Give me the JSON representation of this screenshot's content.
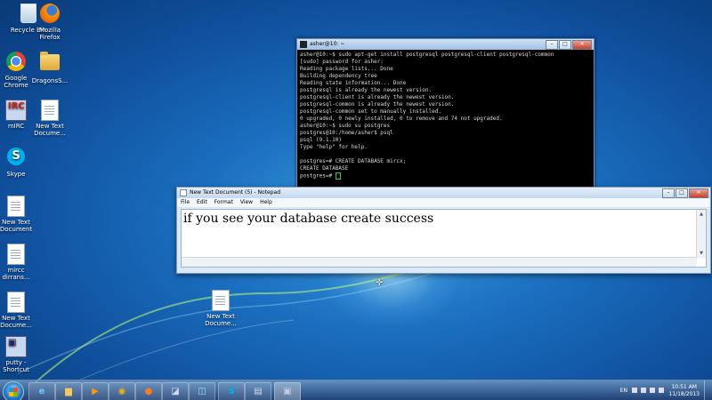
{
  "desktop_icons": {
    "recycle_bin": "Recycle Bin",
    "firefox": "Mozilla\nFirefox",
    "chrome": "Google\nChrome",
    "dragons_folder": "DragonsS...",
    "mirc": "mIRC",
    "new_text_1": "New Text\nDocume...",
    "skype": "Skype",
    "new_text_2": "New Text\nDocument",
    "mirc_dir": "mircc\ndirrans...",
    "new_text_3": "New Text\nDocume...",
    "putty": "putty -\nShortcut",
    "new_text_4": "New Text\nDocume..."
  },
  "terminal": {
    "title": "asher@10: ~",
    "lines": [
      "asher@10:~$ sudo apt-get install postgresql postgresql-client postgresql-common",
      "[sudo] password for asher:",
      "Reading package lists... Done",
      "Building dependency tree",
      "Reading state information... Done",
      "postgresql is already the newest version.",
      "postgresql-client is already the newest version.",
      "postgresql-common is already the newest version.",
      "postgresql-common set to manually installed.",
      "0 upgraded, 0 newly installed, 0 to remove and 74 not upgraded.",
      "asher@10:~$ sudo su postgres",
      "postgres@10:/home/asher$ psql",
      "psql (9.1.10)",
      "Type \"help\" for help.",
      "",
      "postgres=# CREATE DATABASE mircx;",
      "CREATE DATABASE"
    ],
    "prompt": "postgres=# "
  },
  "notepad": {
    "title": "New Text Document (5) - Notepad",
    "menu": [
      "File",
      "Edit",
      "Format",
      "View",
      "Help"
    ],
    "content": "if you see your database create success"
  },
  "taskbar": {
    "language": "EN",
    "time": "10:51 AM",
    "date": "11/18/2013"
  }
}
